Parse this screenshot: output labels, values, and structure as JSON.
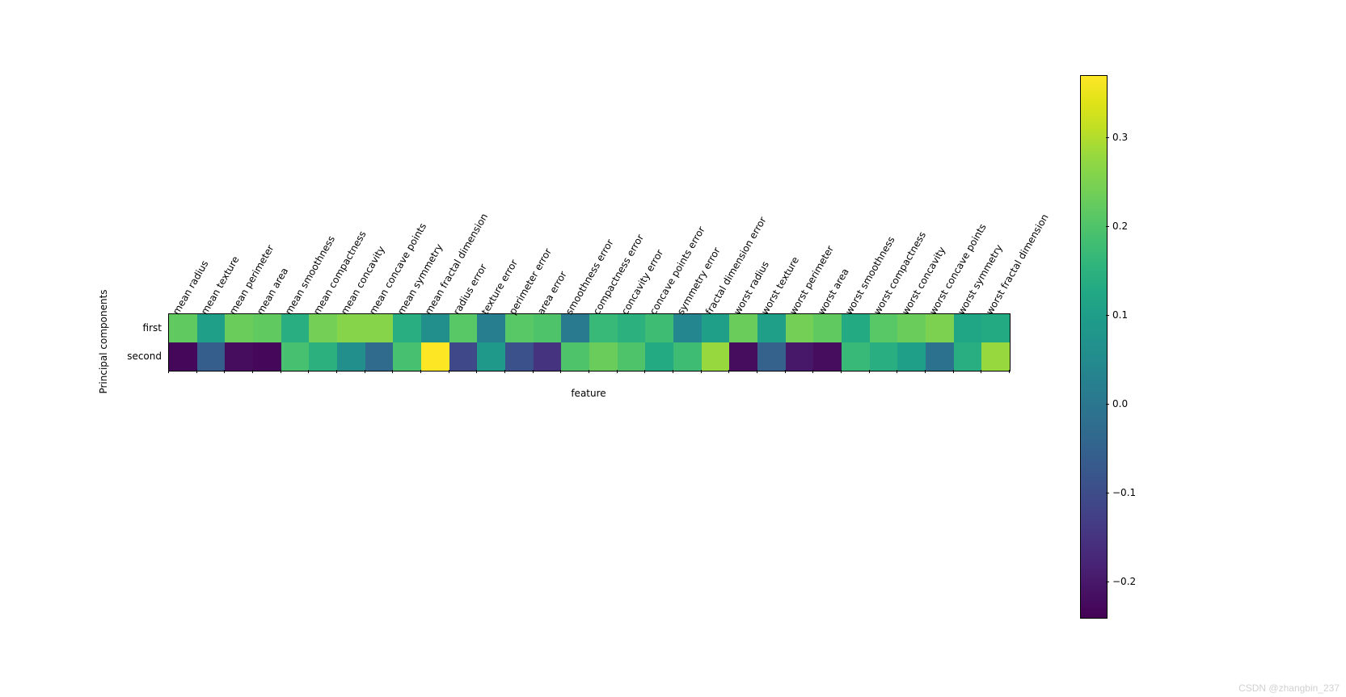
{
  "chart_data": {
    "type": "heatmap",
    "xlabel": "feature",
    "ylabel": "Principal components",
    "categories": [
      "mean radius",
      "mean texture",
      "mean perimeter",
      "mean area",
      "mean smoothness",
      "mean compactness",
      "mean concavity",
      "mean concave points",
      "mean symmetry",
      "mean fractal dimension",
      "radius error",
      "texture error",
      "perimeter error",
      "area error",
      "smoothness error",
      "compactness error",
      "concavity error",
      "concave points error",
      "symmetry error",
      "fractal dimension error",
      "worst radius",
      "worst texture",
      "worst perimeter",
      "worst area",
      "worst smoothness",
      "worst compactness",
      "worst concavity",
      "worst concave points",
      "worst symmetry",
      "worst fractal dimension"
    ],
    "rows": [
      "first",
      "second"
    ],
    "values": [
      [
        0.22,
        0.1,
        0.23,
        0.22,
        0.14,
        0.24,
        0.26,
        0.26,
        0.14,
        0.06,
        0.21,
        0.02,
        0.21,
        0.2,
        0.01,
        0.17,
        0.15,
        0.18,
        0.04,
        0.1,
        0.23,
        0.1,
        0.24,
        0.22,
        0.13,
        0.21,
        0.23,
        0.25,
        0.12,
        0.13
      ],
      [
        -0.23,
        -0.06,
        -0.22,
        -0.23,
        0.19,
        0.15,
        0.06,
        -0.03,
        0.19,
        0.37,
        -0.11,
        0.09,
        -0.09,
        -0.15,
        0.2,
        0.23,
        0.2,
        0.13,
        0.18,
        0.28,
        -0.22,
        -0.05,
        -0.2,
        -0.22,
        0.17,
        0.14,
        0.1,
        -0.01,
        0.14,
        0.28
      ]
    ],
    "vmin": -0.24,
    "vmax": 0.37,
    "colormap": "viridis",
    "colorbar_ticks": [
      -0.2,
      -0.1,
      0.0,
      0.1,
      0.2,
      0.3
    ]
  },
  "watermark": "CSDN @zhangbin_237"
}
